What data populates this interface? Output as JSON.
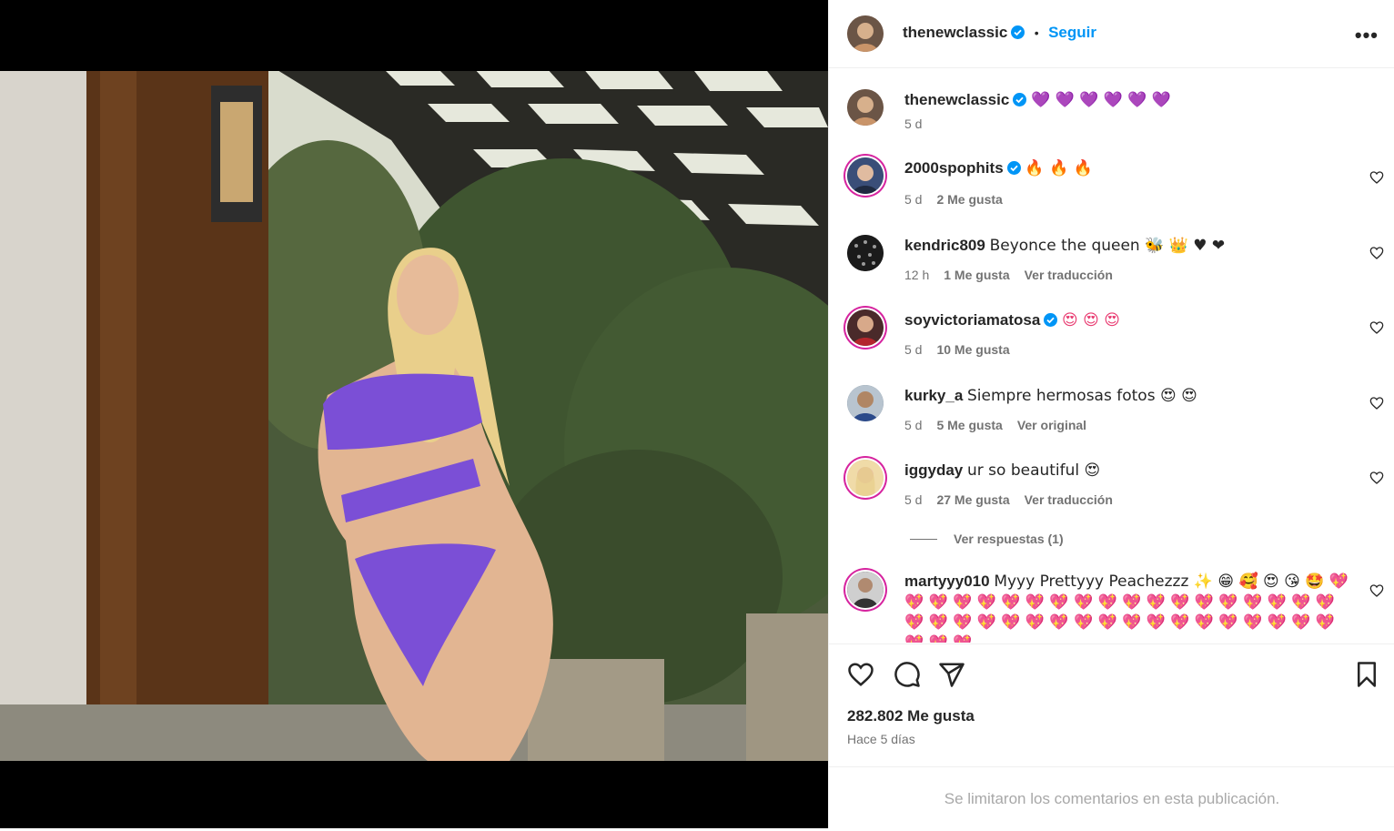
{
  "post": {
    "author": "thenewclassic",
    "follow_label": "Seguir",
    "more_label": "•••",
    "separator": "•",
    "caption": {
      "username": "thenewclassic",
      "text": "💜 💜 💜 💜 💜 💜",
      "time": "5 d"
    },
    "likes": "282.802 Me gusta",
    "posted_ago": "Hace 5 días",
    "footer_notice": "Se limitaron los comentarios en esta publicación."
  },
  "comments": [
    {
      "username": "2000spophits",
      "verified": true,
      "text": "🔥 🔥 🔥",
      "time": "5 d",
      "likes": "2 Me gusta",
      "extra": ""
    },
    {
      "username": "kendric809",
      "verified": false,
      "text": "Beyonce the queen 🐝 👑 ♥ ❤",
      "time": "12 h",
      "likes": "1 Me gusta",
      "extra": "Ver traducción"
    },
    {
      "username": "soyvictoriamatosa",
      "verified": true,
      "text": "😍 😍 😍",
      "time": "5 d",
      "likes": "10 Me gusta",
      "extra": ""
    },
    {
      "username": "kurky_a",
      "verified": false,
      "text": "Siempre hermosas fotos 😍 😍",
      "time": "5 d",
      "likes": "5 Me gusta",
      "extra": "Ver original"
    },
    {
      "username": "iggyday",
      "verified": false,
      "text": "ur so beautiful 😍",
      "time": "5 d",
      "likes": "27 Me gusta",
      "extra": "Ver traducción"
    },
    {
      "username": "martyyy010",
      "verified": false,
      "text": "Myyy Prettyyy Peachezzz ✨ 😁 🥰 😍 😘 🤩 💖 💖 💖 💖 💖 💖 💖 💖 💖 💖 💖 💖 💖 💖 💖 💖 💖 💖 💖 💖 💖 💖 💖 💖 💖 💖 💖 💖 💖 💖 💖 💖 💖 💖 💖 💖 💖 💖 💖 💖",
      "time": "",
      "likes": "",
      "extra": ""
    }
  ],
  "replies_label": "Ver respuestas (1)",
  "icons": {
    "like": "heart-icon",
    "comment": "comment-icon",
    "share": "send-icon",
    "save": "bookmark-icon",
    "verified": "verified-badge-icon",
    "more": "more-options-icon"
  },
  "colors": {
    "link": "#0095f6",
    "verified": "#0095f6",
    "muted": "#737373",
    "swimsuit": "#7b4fd6"
  }
}
